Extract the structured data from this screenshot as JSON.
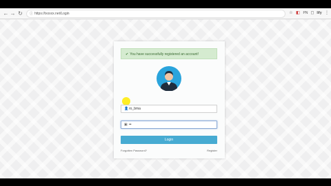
{
  "browser": {
    "url": "https://ixxxxx.net/Login",
    "nav": {
      "back": "←",
      "forward": "→",
      "reload": "↻",
      "home": "⌂"
    },
    "toolbar_icons": [
      "☆",
      "◧",
      "PN",
      "◻",
      "Iify",
      "⋮"
    ]
  },
  "login": {
    "alert_text": "You have successfully registered an account!",
    "username_value": "ro_bma",
    "password_value": "••",
    "login_label": "Login",
    "forgot_label": "Forgotten Password?",
    "register_label": "Register"
  },
  "colors": {
    "alert_bg": "#d5ebd0",
    "button": "#47abd2",
    "avatar": "#2aa4dc"
  }
}
